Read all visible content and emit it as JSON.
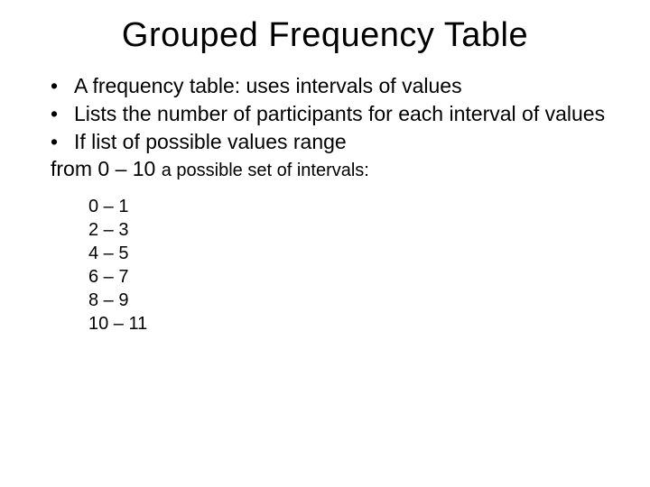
{
  "title": "Grouped Frequency Table",
  "bullets": [
    "A frequency table: uses intervals of values",
    "Lists the number of participants for each interval of values",
    "If list of possible values range"
  ],
  "rangeLine": {
    "lead": "from 0 – 10 ",
    "tail": "a possible set of intervals:"
  },
  "intervals": [
    "0 – 1",
    "2 – 3",
    "4 – 5",
    "6 – 7",
    "8 – 9",
    "10 – 11"
  ]
}
